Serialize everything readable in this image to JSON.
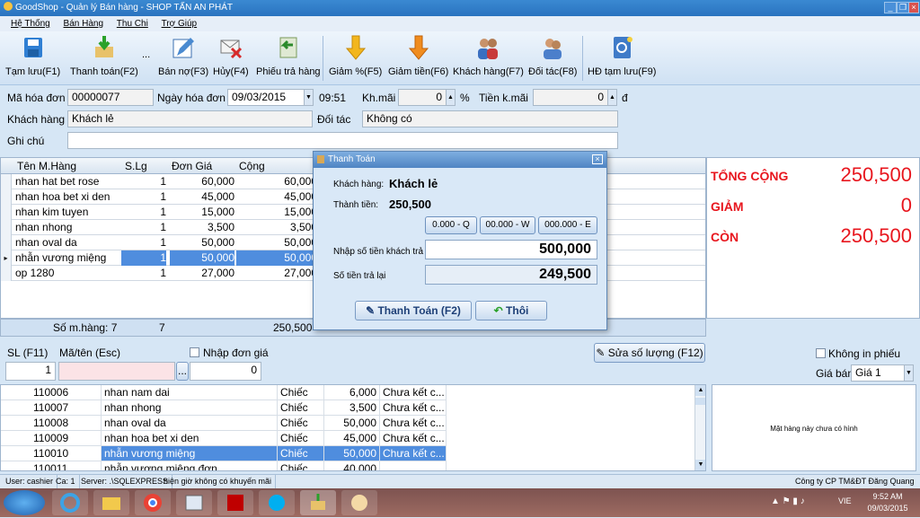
{
  "window": {
    "title": "GoodShop - Quản lý Bán hàng - SHOP TẤN AN PHÁT"
  },
  "menu": [
    "Hệ Thống",
    "Bán Hàng",
    "Thu Chi",
    "Trợ Giúp"
  ],
  "toolbar": [
    {
      "label": "Tạm lưu(F1)",
      "icon": "save-icon"
    },
    {
      "label": "Thanh toán(F2)",
      "icon": "payment-box-icon"
    },
    {
      "label": "...",
      "icon": "more-icon"
    },
    {
      "label": "Bán nợ(F3)",
      "icon": "pencil-note-icon"
    },
    {
      "label": "Hủy(F4)",
      "icon": "cancel-mail-icon"
    },
    {
      "label": "Phiếu trả hàng",
      "icon": "return-icon"
    },
    {
      "label": "Giảm %(F5)",
      "icon": "arrow-down-icon"
    },
    {
      "label": "Giảm tiền(F6)",
      "icon": "arrow-down-orange-icon"
    },
    {
      "label": "Khách hàng(F7)",
      "icon": "customers-icon"
    },
    {
      "label": "Đối tác(F8)",
      "icon": "partners-icon"
    },
    {
      "label": "HĐ tạm lưu(F9)",
      "icon": "address-book-icon"
    }
  ],
  "form": {
    "invoice_label": "Mã hóa đơn",
    "invoice_value": "00000077",
    "date_label": "Ngày hóa đơn",
    "date_value": "09/03/2015",
    "time_value": "09:51",
    "discount_label": "Kh.mãi",
    "discount_value": "0",
    "percent": "%",
    "discount_money_label": "Tiền k.mãi",
    "discount_money_value": "0",
    "currency": "đ",
    "customer_label": "Khách hàng",
    "customer_value": "Khách lẻ",
    "partner_label": "Đối tác",
    "partner_value": "Không có",
    "note_label": "Ghi chú",
    "note_value": ""
  },
  "cart": {
    "headers": [
      "Tên M.Hàng",
      "S.Lg",
      "Đơn Giá",
      "Cộng"
    ],
    "rows": [
      {
        "name": "nhan hat bet rose",
        "qty": "1",
        "price": "60,000",
        "total": "60,000"
      },
      {
        "name": "nhan hoa bet xi den",
        "qty": "1",
        "price": "45,000",
        "total": "45,000"
      },
      {
        "name": "nhan kim tuyen",
        "qty": "1",
        "price": "15,000",
        "total": "15,000"
      },
      {
        "name": "nhan nhong",
        "qty": "1",
        "price": "3,500",
        "total": "3,500"
      },
      {
        "name": "nhan oval da",
        "qty": "1",
        "price": "50,000",
        "total": "50,000"
      },
      {
        "name": "nhẫn vương miệng",
        "qty": "1",
        "price": "50,000",
        "total": "50,000"
      },
      {
        "name": "op 1280",
        "qty": "1",
        "price": "27,000",
        "total": "27,000"
      }
    ],
    "footer_items": "Số m.hàng: 7",
    "footer_qty": "7",
    "footer_total": "250,500"
  },
  "totals": {
    "total_label": "TỔNG CỘNG",
    "total_value": "250,500",
    "discount_label": "GIẢM",
    "discount_value": "0",
    "remain_label": "CÒN",
    "remain_value": "250,500"
  },
  "entry": {
    "qty_label": "SL (F11)",
    "qty_value": "1",
    "code_label": "Mã/tên (Esc)",
    "code_value": "",
    "price_check_label": "Nhập đơn giá",
    "price_value": "0",
    "edit_qty_button": "Sửa số lượng (F12)",
    "no_print_label": "Không in phiếu",
    "price_level_label": "Giá bán",
    "price_level_value": "Giá 1"
  },
  "products": {
    "rows": [
      {
        "code": "110006",
        "name": "nhan nam dai",
        "unit": "Chiếc",
        "price": "6,000",
        "note": "Chưa kết c..."
      },
      {
        "code": "110007",
        "name": "nhan nhong",
        "unit": "Chiếc",
        "price": "3,500",
        "note": "Chưa kết c..."
      },
      {
        "code": "110008",
        "name": "nhan oval da",
        "unit": "Chiếc",
        "price": "50,000",
        "note": "Chưa kết c..."
      },
      {
        "code": "110009",
        "name": "nhan hoa bet xi den",
        "unit": "Chiếc",
        "price": "45,000",
        "note": "Chưa kết c..."
      },
      {
        "code": "110010",
        "name": "nhẫn vương miệng",
        "unit": "Chiếc",
        "price": "50,000",
        "note": "Chưa kết c..."
      },
      {
        "code": "110011",
        "name": "nhẫn vương miệng đơn",
        "unit": "Chiếc",
        "price": "40,000",
        "note": ""
      }
    ],
    "no_image_text": "Mặt hàng này chưa có hình"
  },
  "status": {
    "user": "User: cashier",
    "shift": "Ca: 1",
    "server": "Server: .\\SQLEXPRESS",
    "promo": "hiện giờ không có khuyến mãi",
    "company": "Công ty CP TM&ĐT Đăng Quang"
  },
  "dialog": {
    "title": "Thanh Toán",
    "customer_label": "Khách hàng:",
    "customer_value": "Khách lẻ",
    "amount_label": "Thành tiền:",
    "amount_value": "250,500",
    "quick": [
      "0.000 - Q",
      "00.000 - W",
      "000.000 - E"
    ],
    "paid_label": "Nhập số tiền khách trả",
    "paid_value": "500,000",
    "change_label": "Số tiền trả lại",
    "change_value": "249,500",
    "pay_button": "Thanh Toán (F2)",
    "cancel_button": "Thôi"
  },
  "tray": {
    "lang": "VIE",
    "time": "9:52 AM",
    "date": "09/03/2015"
  }
}
